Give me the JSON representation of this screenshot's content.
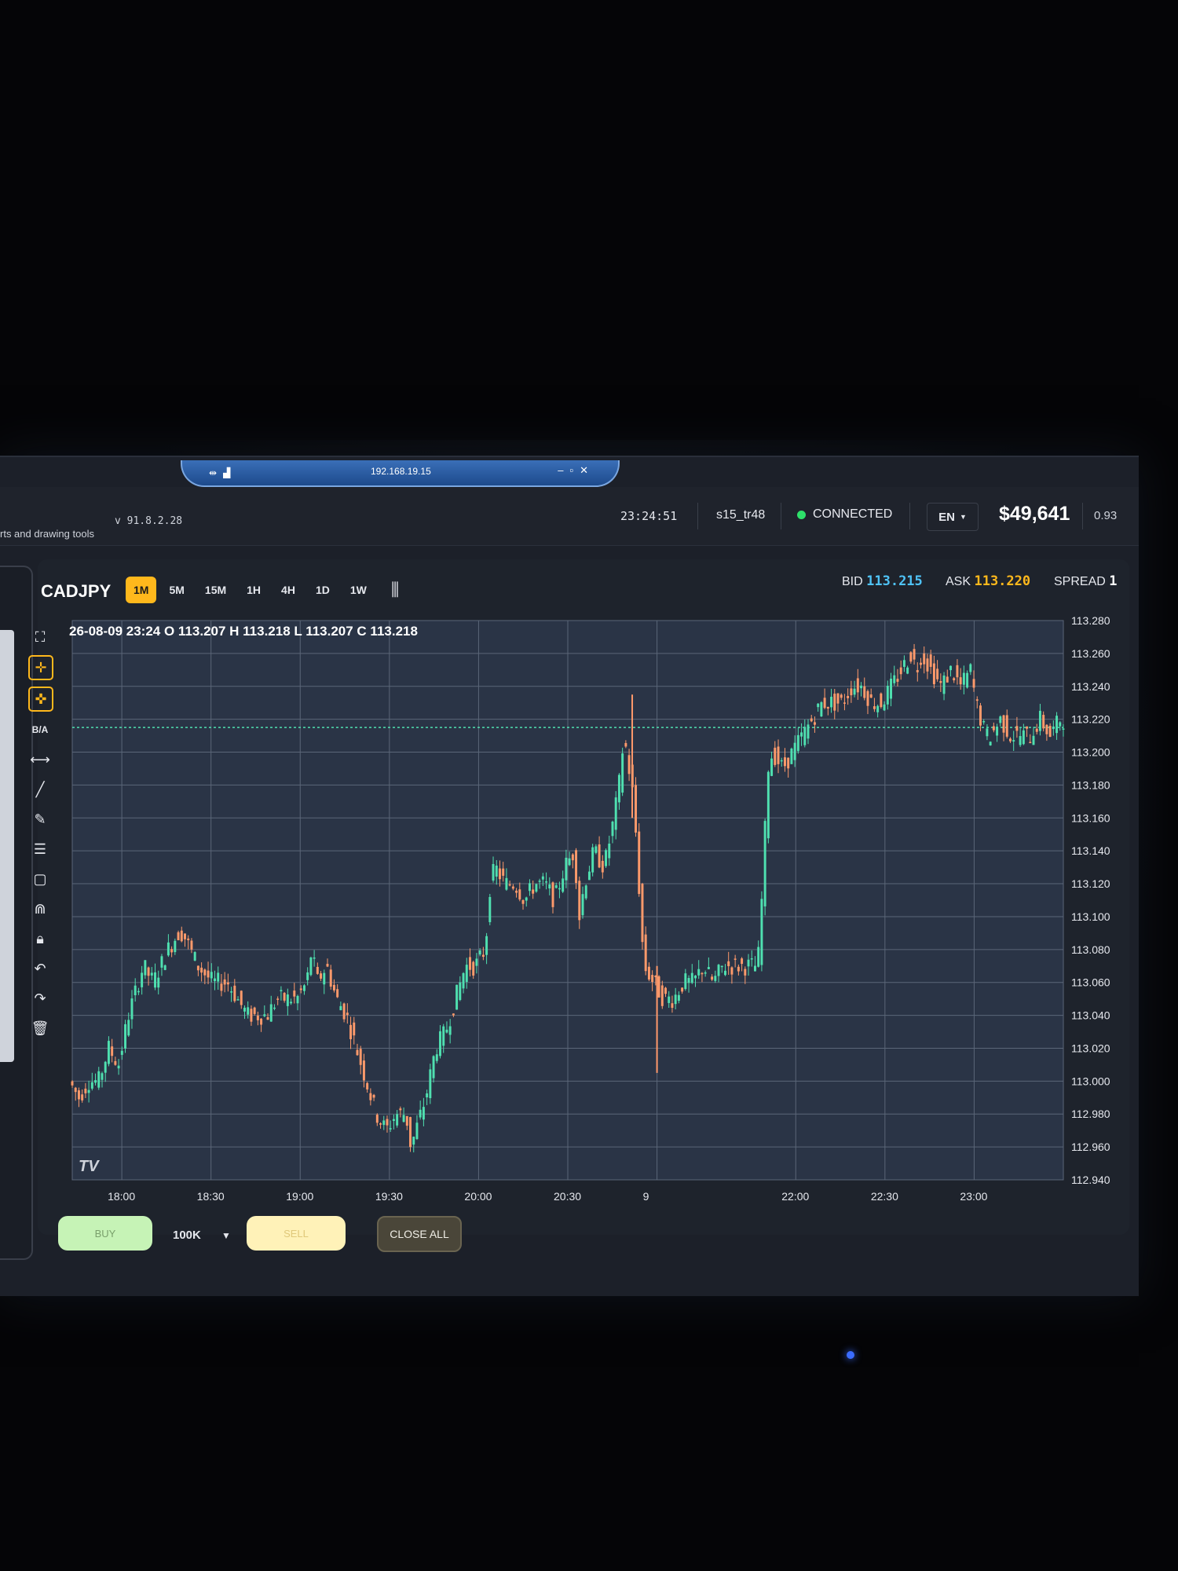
{
  "rdp": {
    "ip": "192.168.19.15",
    "pin_icon": "pin-icon",
    "signal_icon": "signal-icon",
    "controls": [
      "–",
      "▫",
      "✕"
    ]
  },
  "topbar": {
    "left_text": "rts and drawing tools",
    "version": "v 91.8.2.28",
    "time": "23:24:51",
    "user": "s15_tr48",
    "status": "CONNECTED",
    "status_color": "#2ee06a",
    "language": "EN",
    "balance": "$49,641",
    "extra": "0.93"
  },
  "toolbar": {
    "symbol": "CADJPY",
    "timeframes": [
      "1M",
      "5M",
      "15M",
      "1H",
      "4H",
      "1D",
      "1W"
    ],
    "active_timeframe": "1M",
    "chart_type_icon": "candlestick-icon"
  },
  "quote": {
    "bid_label": "BID",
    "bid": "113.215",
    "ask_label": "ASK",
    "ask": "113.220",
    "spread_label": "SPREAD",
    "spread": "1"
  },
  "tools": [
    "fullscreen-icon",
    "crosshair-icon",
    "crosshair-alt-icon",
    "B/A",
    "measure-icon",
    "trendline-icon",
    "pencil-icon",
    "fib-icon",
    "rectangle-icon",
    "magnet-icon",
    "lock-icon",
    "undo-icon",
    "redo-icon",
    "trash-icon"
  ],
  "chart_data": {
    "type": "candlestick",
    "ohlc_header": "26-08-09 23:24 O 113.207 H 113.218 L 113.207 C 113.218",
    "watermark": "TV",
    "ylim": [
      112.94,
      113.28
    ],
    "y_ticks": [
      "113.280",
      "113.260",
      "113.240",
      "113.220",
      "113.200",
      "113.180",
      "113.160",
      "113.140",
      "113.120",
      "113.100",
      "113.080",
      "113.060",
      "113.040",
      "113.020",
      "113.000",
      "112.980",
      "112.960",
      "112.940"
    ],
    "x_ticks": [
      {
        "label": "18:00",
        "pos": 0.05
      },
      {
        "label": "18:30",
        "pos": 0.14
      },
      {
        "label": "19:00",
        "pos": 0.23
      },
      {
        "label": "19:30",
        "pos": 0.32
      },
      {
        "label": "20:00",
        "pos": 0.41
      },
      {
        "label": "20:30",
        "pos": 0.5
      },
      {
        "label": "9",
        "pos": 0.59
      },
      {
        "label": "22:00",
        "pos": 0.73
      },
      {
        "label": "22:30",
        "pos": 0.82
      },
      {
        "label": "23:00",
        "pos": 0.91
      }
    ],
    "bid_line": 113.215,
    "up_color": "#4fe0b0",
    "down_color": "#ff9a6b",
    "grid": true,
    "path": [
      [
        0.0,
        113.0
      ],
      [
        0.01,
        112.99
      ],
      [
        0.02,
        113.0
      ],
      [
        0.03,
        113.0
      ],
      [
        0.04,
        113.02
      ],
      [
        0.05,
        113.01
      ],
      [
        0.06,
        113.04
      ],
      [
        0.07,
        113.06
      ],
      [
        0.075,
        113.07
      ],
      [
        0.085,
        113.06
      ],
      [
        0.1,
        113.08
      ],
      [
        0.11,
        113.09
      ],
      [
        0.115,
        113.09
      ],
      [
        0.13,
        113.07
      ],
      [
        0.145,
        113.06
      ],
      [
        0.16,
        113.06
      ],
      [
        0.17,
        113.05
      ],
      [
        0.18,
        113.04
      ],
      [
        0.19,
        113.04
      ],
      [
        0.2,
        113.04
      ],
      [
        0.21,
        113.05
      ],
      [
        0.22,
        113.05
      ],
      [
        0.23,
        113.05
      ],
      [
        0.24,
        113.06
      ],
      [
        0.245,
        113.08
      ],
      [
        0.25,
        113.06
      ],
      [
        0.26,
        113.07
      ],
      [
        0.27,
        113.05
      ],
      [
        0.28,
        113.04
      ],
      [
        0.29,
        113.02
      ],
      [
        0.3,
        113.0
      ],
      [
        0.31,
        112.98
      ],
      [
        0.32,
        112.97
      ],
      [
        0.33,
        112.98
      ],
      [
        0.34,
        112.98
      ],
      [
        0.345,
        112.96
      ],
      [
        0.35,
        112.97
      ],
      [
        0.36,
        112.99
      ],
      [
        0.37,
        113.02
      ],
      [
        0.38,
        113.03
      ],
      [
        0.39,
        113.05
      ],
      [
        0.4,
        113.07
      ],
      [
        0.41,
        113.07
      ],
      [
        0.42,
        113.08
      ],
      [
        0.425,
        113.12
      ],
      [
        0.43,
        113.13
      ],
      [
        0.44,
        113.12
      ],
      [
        0.45,
        113.12
      ],
      [
        0.46,
        113.11
      ],
      [
        0.47,
        113.12
      ],
      [
        0.48,
        113.12
      ],
      [
        0.49,
        113.11
      ],
      [
        0.5,
        113.13
      ],
      [
        0.51,
        113.14
      ],
      [
        0.515,
        113.1
      ],
      [
        0.52,
        113.12
      ],
      [
        0.53,
        113.14
      ],
      [
        0.54,
        113.13
      ],
      [
        0.55,
        113.16
      ],
      [
        0.555,
        113.18
      ],
      [
        0.56,
        113.21
      ],
      [
        0.565,
        113.19
      ],
      [
        0.57,
        113.17
      ],
      [
        0.58,
        113.07
      ],
      [
        0.59,
        113.06
      ],
      [
        0.6,
        113.05
      ],
      [
        0.61,
        113.05
      ],
      [
        0.62,
        113.06
      ],
      [
        0.63,
        113.06
      ],
      [
        0.64,
        113.07
      ],
      [
        0.65,
        113.06
      ],
      [
        0.66,
        113.07
      ],
      [
        0.67,
        113.07
      ],
      [
        0.68,
        113.07
      ],
      [
        0.69,
        113.07
      ],
      [
        0.695,
        113.07
      ],
      [
        0.7,
        113.12
      ],
      [
        0.705,
        113.19
      ],
      [
        0.71,
        113.2
      ],
      [
        0.72,
        113.19
      ],
      [
        0.73,
        113.2
      ],
      [
        0.74,
        113.21
      ],
      [
        0.75,
        113.22
      ],
      [
        0.76,
        113.23
      ],
      [
        0.77,
        113.23
      ],
      [
        0.78,
        113.23
      ],
      [
        0.79,
        113.24
      ],
      [
        0.8,
        113.24
      ],
      [
        0.81,
        113.23
      ],
      [
        0.82,
        113.23
      ],
      [
        0.83,
        113.24
      ],
      [
        0.84,
        113.25
      ],
      [
        0.85,
        113.26
      ],
      [
        0.855,
        113.25
      ],
      [
        0.86,
        113.26
      ],
      [
        0.87,
        113.25
      ],
      [
        0.88,
        113.24
      ],
      [
        0.89,
        113.25
      ],
      [
        0.9,
        113.24
      ],
      [
        0.91,
        113.25
      ],
      [
        0.915,
        113.23
      ],
      [
        0.92,
        113.22
      ],
      [
        0.925,
        113.21
      ],
      [
        0.93,
        113.21
      ],
      [
        0.94,
        113.22
      ],
      [
        0.95,
        113.21
      ],
      [
        0.96,
        113.21
      ],
      [
        0.97,
        113.21
      ],
      [
        0.98,
        113.22
      ],
      [
        0.99,
        113.21
      ],
      [
        1.0,
        113.22
      ]
    ]
  },
  "trade": {
    "buy_label": "BUY",
    "lot": "100K",
    "sell_label": "SELL",
    "close_all_label": "CLOSE ALL"
  }
}
